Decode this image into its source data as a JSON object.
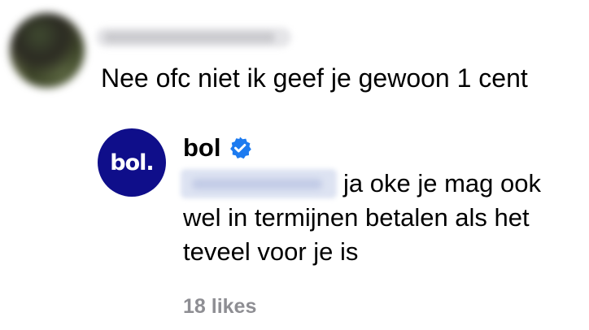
{
  "comment": {
    "text": "Nee ofc niet ik geef je gewoon 1 cent"
  },
  "reply": {
    "avatar_logo_text": "bol.",
    "username": "bol",
    "verified_icon": "verified-badge-icon",
    "verified_color": "#1d7bf0",
    "brand_color": "#0f0e8a",
    "text": "ja oke je mag ook wel in termijnen betalen als het teveel voor je is",
    "likes": "18 likes"
  }
}
